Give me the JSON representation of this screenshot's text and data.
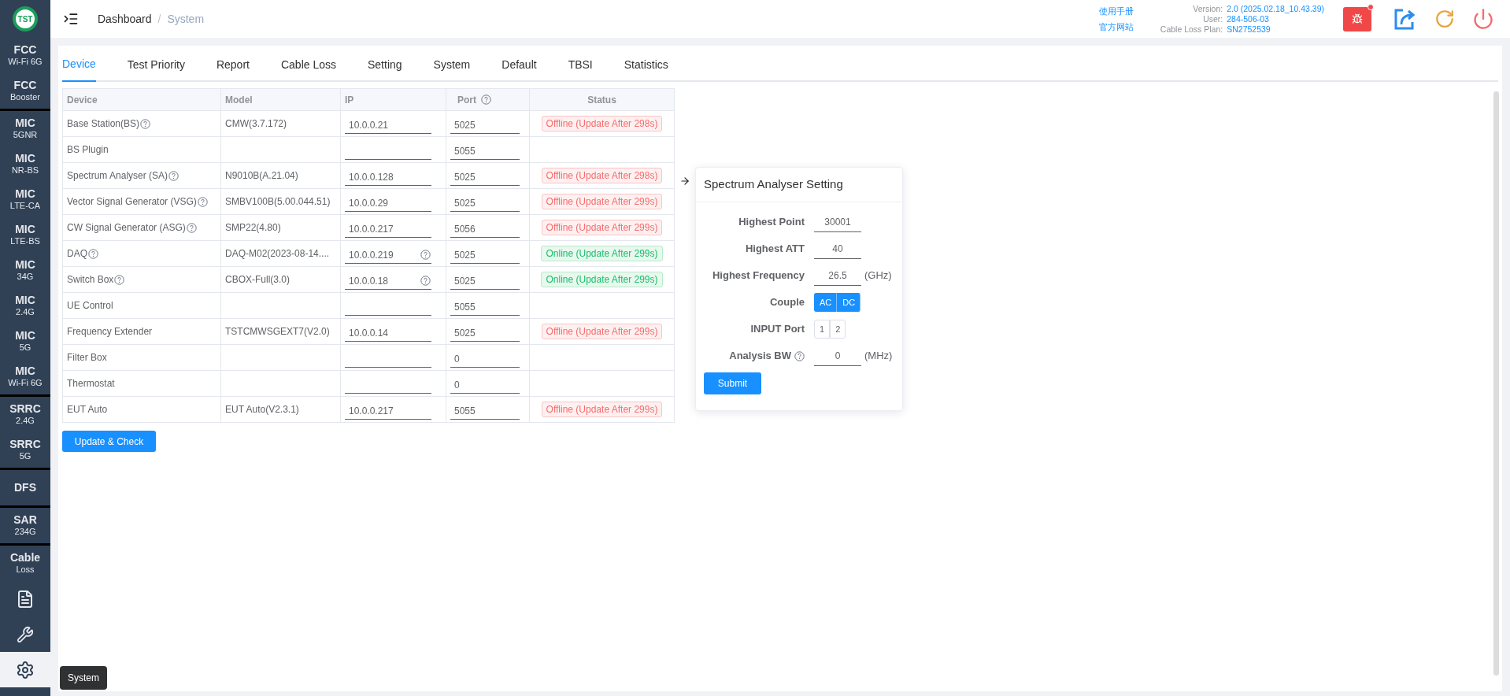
{
  "sidebar": {
    "groups": [
      [
        {
          "kind": "text",
          "title": "FCC",
          "subtitle": "Wi-Fi 6G",
          "selected": false
        },
        {
          "kind": "text",
          "title": "FCC",
          "subtitle": "Booster",
          "selected": false
        }
      ],
      [
        {
          "kind": "text",
          "title": "MIC",
          "subtitle": "5GNR",
          "selected": false
        },
        {
          "kind": "text",
          "title": "MIC",
          "subtitle": "NR-BS",
          "selected": false
        },
        {
          "kind": "text",
          "title": "MIC",
          "subtitle": "LTE-CA",
          "selected": false
        },
        {
          "kind": "text",
          "title": "MIC",
          "subtitle": "LTE-BS",
          "selected": false
        },
        {
          "kind": "text",
          "title": "MIC",
          "subtitle": "34G",
          "selected": false
        },
        {
          "kind": "text",
          "title": "MIC",
          "subtitle": "2.4G",
          "selected": false
        },
        {
          "kind": "text",
          "title": "MIC",
          "subtitle": "5G",
          "selected": false
        },
        {
          "kind": "text",
          "title": "MIC",
          "subtitle": "Wi-Fi 6G",
          "selected": false
        }
      ],
      [
        {
          "kind": "text",
          "title": "SRRC",
          "subtitle": "2.4G",
          "selected": false
        },
        {
          "kind": "text",
          "title": "SRRC",
          "subtitle": "5G",
          "selected": false
        }
      ],
      [
        {
          "kind": "text",
          "title": "DFS",
          "selected": false
        }
      ],
      [
        {
          "kind": "text",
          "title": "SAR",
          "subtitle": "234G",
          "selected": false
        }
      ],
      [
        {
          "kind": "text",
          "title": "Cable",
          "subtitle": "Loss",
          "selected": false
        },
        {
          "kind": "doc",
          "selected": false
        },
        {
          "kind": "wrench",
          "selected": false
        },
        {
          "kind": "gear",
          "selected": true
        }
      ]
    ],
    "tooltip": "System"
  },
  "logo": "TST",
  "header": {
    "breadcrumb": [
      "Dashboard",
      "System"
    ],
    "breadcrumb_separator": "/",
    "links": [
      "使用手册",
      "官方网站"
    ],
    "info": [
      {
        "label": "Version:",
        "value": "2.0 (2025.02.18_10.43.39)"
      },
      {
        "label": "User:",
        "value": "284-506-03"
      },
      {
        "label": "Cable Loss Plan:",
        "value": "SN2752539"
      }
    ]
  },
  "tabs": [
    {
      "label": "Device",
      "selected": true
    },
    {
      "label": "Test Priority",
      "selected": false
    },
    {
      "label": "Report",
      "selected": false
    },
    {
      "label": "Cable Loss",
      "selected": false
    },
    {
      "label": "Setting",
      "selected": false
    },
    {
      "label": "System",
      "selected": false
    },
    {
      "label": "Default",
      "selected": false
    },
    {
      "label": "TBSI",
      "selected": false
    },
    {
      "label": "Statistics",
      "selected": false
    }
  ],
  "table": {
    "columns": [
      {
        "label": "Device",
        "help": false
      },
      {
        "label": "Model",
        "help": false
      },
      {
        "label": "IP",
        "help": false
      },
      {
        "label": "Port",
        "help": true
      },
      {
        "label": "Status",
        "help": false
      }
    ],
    "rows": [
      {
        "device": "Base Station(BS)",
        "help": true,
        "model": "CMW(3.7.172)",
        "ip": "10.0.0.21",
        "ip_help": false,
        "port": "5025",
        "status": {
          "text": "Offline (Update After 298s)",
          "online": false
        }
      },
      {
        "device": "BS Plugin",
        "help": false,
        "model": "",
        "ip": "",
        "ip_help": false,
        "port": "5055",
        "status": null
      },
      {
        "device": "Spectrum Analyser (SA)",
        "help": true,
        "model": "N9010B(A.21.04)",
        "ip": "10.0.0.128",
        "ip_help": false,
        "port": "5025",
        "status": {
          "text": "Offline (Update After 298s)",
          "online": false
        }
      },
      {
        "device": "Vector Signal Generator (VSG)",
        "help": true,
        "model": "SMBV100B(5.00.044.51)",
        "ip": "10.0.0.29",
        "ip_help": false,
        "port": "5025",
        "status": {
          "text": "Offline (Update After 299s)",
          "online": false
        }
      },
      {
        "device": "CW Signal Generator (ASG)",
        "help": true,
        "model": "SMP22(4.80)",
        "ip": "10.0.0.217",
        "ip_help": false,
        "port": "5056",
        "status": {
          "text": "Offline (Update After 299s)",
          "online": false
        }
      },
      {
        "device": "DAQ",
        "help": true,
        "model": "DAQ-M02(2023-08-14....",
        "ip": "10.0.0.219",
        "ip_help": true,
        "port": "5025",
        "status": {
          "text": "Online (Update After 299s)",
          "online": true
        }
      },
      {
        "device": "Switch Box",
        "help": true,
        "model": "CBOX-Full(3.0)",
        "ip": "10.0.0.18",
        "ip_help": true,
        "port": "5025",
        "status": {
          "text": "Online (Update After 299s)",
          "online": true
        }
      },
      {
        "device": "UE Control",
        "help": false,
        "model": "",
        "ip": "",
        "ip_help": false,
        "port": "5055",
        "status": null
      },
      {
        "device": "Frequency Extender",
        "help": false,
        "model": "TSTCMWSGEXT7(V2.0)",
        "ip": "10.0.0.14",
        "ip_help": false,
        "port": "5025",
        "status": {
          "text": "Offline (Update After 299s)",
          "online": false
        }
      },
      {
        "device": "Filter Box",
        "help": false,
        "model": "",
        "ip": "",
        "ip_help": false,
        "port": "0",
        "status": null
      },
      {
        "device": "Thermostat",
        "help": false,
        "model": "",
        "ip": "",
        "ip_help": false,
        "port": "0",
        "status": null
      },
      {
        "device": "EUT Auto",
        "help": false,
        "model": "EUT Auto(V2.3.1)",
        "ip": "10.0.0.217",
        "ip_help": false,
        "port": "5055",
        "status": {
          "text": "Offline (Update After 299s)",
          "online": false
        }
      }
    ]
  },
  "update_button": "Update & Check",
  "popover": {
    "title": "Spectrum Analyser Setting",
    "fields": [
      {
        "kind": "input",
        "label": "Highest Point",
        "help": false,
        "value": "30001"
      },
      {
        "kind": "input",
        "label": "Highest ATT",
        "help": false,
        "value": "40"
      },
      {
        "kind": "input",
        "label": "Highest Frequency",
        "help": false,
        "value": "26.5",
        "unit": "(GHz)"
      },
      {
        "kind": "segmented",
        "label": "Couple",
        "options": [
          {
            "label": "AC",
            "selected": true
          },
          {
            "label": "DC",
            "selected": true
          }
        ]
      },
      {
        "kind": "segmented",
        "label": "INPUT Port",
        "options": [
          {
            "label": "1",
            "selected": false
          },
          {
            "label": "2",
            "selected": false
          }
        ]
      },
      {
        "kind": "input",
        "label": "Analysis BW",
        "help": true,
        "value": "0",
        "unit": "(MHz)"
      }
    ],
    "submit": "Submit"
  }
}
